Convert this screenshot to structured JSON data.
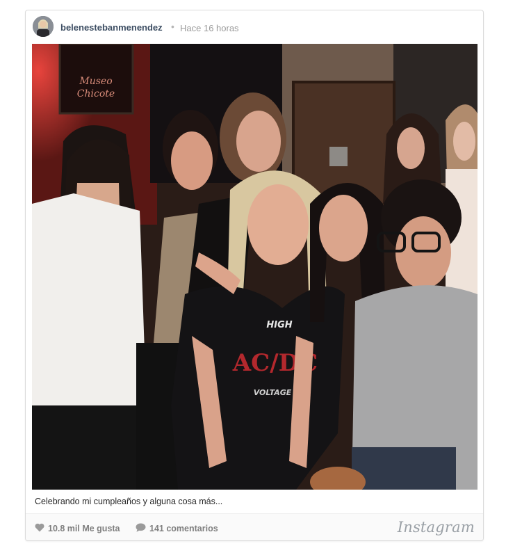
{
  "post": {
    "username": "belenestebanmenendez",
    "separator": "•",
    "timestamp": "Hace 16 horas",
    "caption": "Celebrando mi cumpleaños y alguna cosa más...",
    "likes": "10.8 mil Me gusta",
    "comments": "141 comentarios",
    "brand": "Instagram"
  },
  "photo_signage": {
    "line1": "Museo",
    "line2": "Chicote"
  },
  "shirt_print": {
    "top": "HIGH",
    "logo": "AC/DC",
    "bottom": "VOLTAGE"
  },
  "icons": {
    "like": "heart-icon",
    "comment": "speech-bubble-icon"
  },
  "colors": {
    "username": "#3d4e63",
    "meta": "#9a9a9a",
    "footer_text": "#7f7f7f",
    "brand": "#9aa0a6"
  }
}
